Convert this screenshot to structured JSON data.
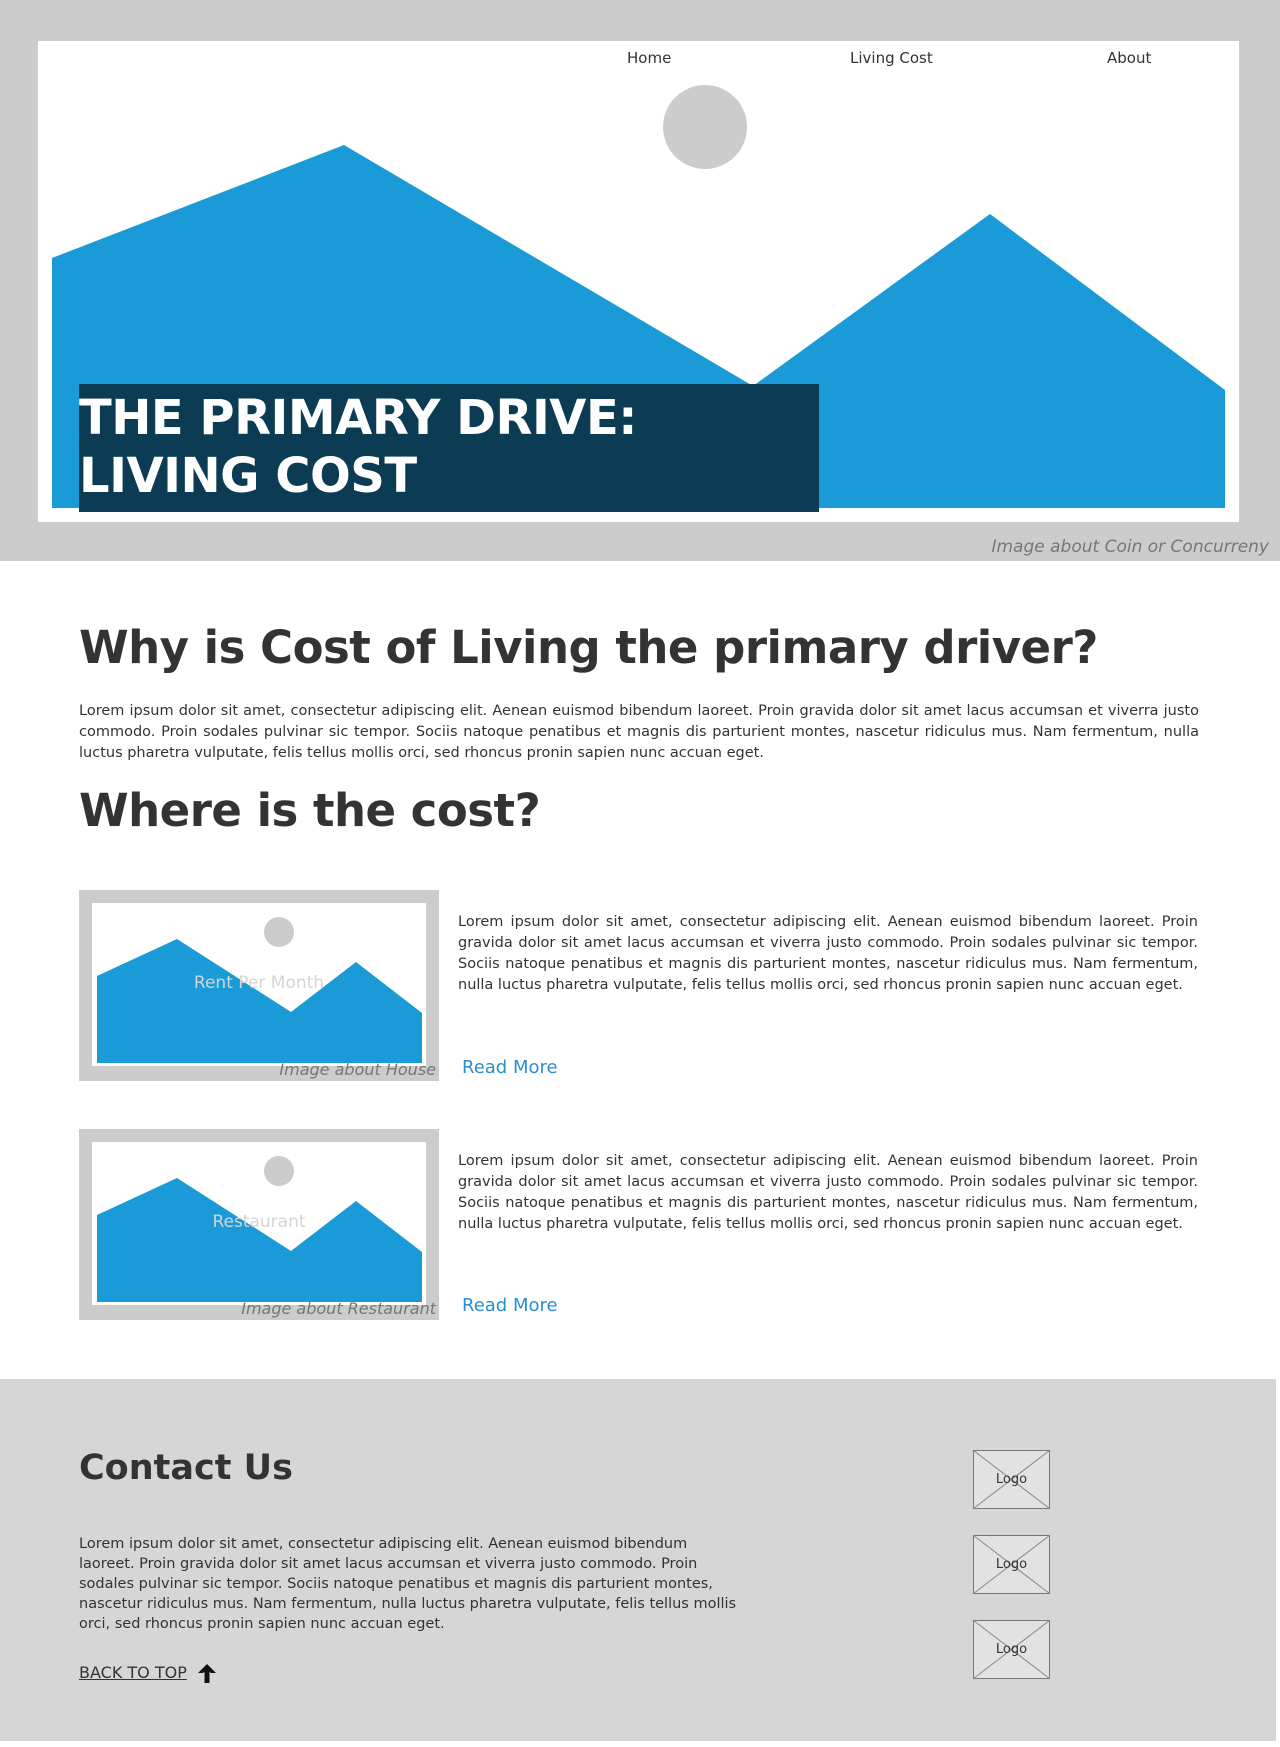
{
  "nav": {
    "home": "Home",
    "living_cost": "Living Cost",
    "about": "About"
  },
  "hero": {
    "title_line1": "THE PRIMARY DRIVE:",
    "title_line2": "LIVING COST",
    "caption": "Image about Coin or Concurreny"
  },
  "why": {
    "heading": "Why is Cost of Living the primary driver?",
    "body": "Lorem ipsum dolor sit amet, consectetur adipiscing elit. Aenean euismod bibendum laoreet. Proin gravida dolor sit amet lacus accumsan et viverra justo commodo. Proin sodales pulvinar sic tempor. Sociis natoque penatibus et magnis dis parturient montes, nascetur ridiculus mus. Nam fermentum, nulla luctus pharetra vulputate, felis tellus mollis orci, sed rhoncus pronin sapien nunc accuan eget."
  },
  "where": {
    "heading": "Where is the cost?",
    "cards": [
      {
        "image_label": "Rent Per Month",
        "image_caption": "Image about House",
        "body": "Lorem ipsum dolor sit amet, consectetur adipiscing elit. Aenean euismod bibendum laoreet. Proin gravida dolor sit amet lacus accumsan et viverra justo commodo. Proin sodales pulvinar sic tempor. Sociis natoque penatibus et magnis dis parturient montes, nascetur ridiculus mus. Nam fermentum, nulla luctus pharetra vulputate, felis tellus mollis orci, sed rhoncus pronin sapien nunc accuan eget.",
        "link": "Read More"
      },
      {
        "image_label": "Restaurant",
        "image_caption": "Image about Restaurant",
        "body": "Lorem ipsum dolor sit amet, consectetur adipiscing elit. Aenean euismod bibendum laoreet. Proin gravida dolor sit amet lacus accumsan et viverra justo commodo. Proin sodales pulvinar sic tempor. Sociis natoque penatibus et magnis dis parturient montes, nascetur ridiculus mus. Nam fermentum, nulla luctus pharetra vulputate, felis tellus mollis orci, sed rhoncus pronin sapien nunc accuan eget.",
        "link": "Read More"
      }
    ]
  },
  "footer": {
    "title": "Contact Us",
    "body": "Lorem ipsum dolor sit amet, consectetur adipiscing elit. Aenean euismod bibendum laoreet. Proin gravida dolor sit amet lacus accumsan et viverra justo commodo. Proin sodales pulvinar sic tempor. Sociis natoque penatibus et magnis dis parturient montes, nascetur ridiculus mus. Nam fermentum, nulla luctus pharetra vulputate, felis tellus mollis orci, sed rhoncus pronin sapien nunc accuan eget.",
    "back_to_top": "BACK TO TOP",
    "back_to_top_icon": "arrow-up-icon",
    "logos": [
      "Logo",
      "Logo",
      "Logo"
    ]
  },
  "colors": {
    "accent_blue": "#1a9ad6",
    "title_box": "#0b3c53",
    "link": "#2a8fd0",
    "placeholder_gray": "#cccccc",
    "footer_bg": "#d6d6d6"
  }
}
